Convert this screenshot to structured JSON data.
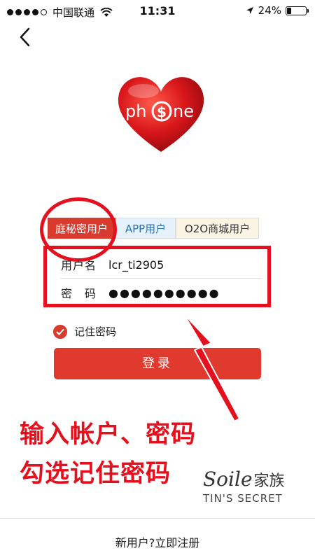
{
  "status_bar": {
    "carrier": "中国联通",
    "time": "11:31",
    "battery": "24%",
    "battery_level": 0.24
  },
  "logo": {
    "text_left": "ph",
    "text_right": "ne",
    "symbol": "$"
  },
  "tabs": [
    {
      "label": "庭秘密用户",
      "active": true
    },
    {
      "label": "APP用户",
      "active": false
    },
    {
      "label": "O2O商城用户",
      "active": false
    }
  ],
  "form": {
    "username_label": "用户名",
    "username_value": "lcr_ti2905",
    "password_label": "密　码",
    "password_value": "●●●●●●●●●●"
  },
  "remember": {
    "label": "记住密码",
    "checked": true
  },
  "login_button": "登录",
  "annotations": {
    "line1": "输入帐户、密码",
    "line2": "勾选记住密码",
    "color": "#e5101d"
  },
  "watermark": {
    "brand": "Soile",
    "brand_cn": "家族",
    "sub": "TIN'S SECRET"
  },
  "register_link": "新用户?立即注册",
  "colors": {
    "accent": "#d83a2e",
    "annotation": "#e5101d"
  }
}
